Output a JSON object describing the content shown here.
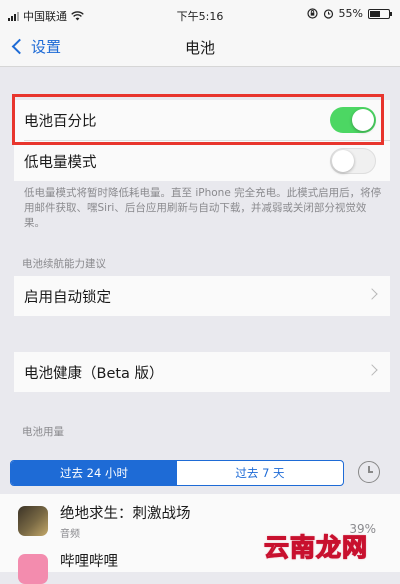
{
  "status_bar": {
    "carrier": "中国联通",
    "time": "下午5:16",
    "battery_percent": "55%",
    "battery_level": 0.55
  },
  "nav": {
    "back_label": "设置",
    "title": "电池"
  },
  "battery_percentage": {
    "label": "电池百分比",
    "enabled": true
  },
  "low_power_mode": {
    "label": "低电量模式",
    "enabled": false
  },
  "low_power_footnote": "低电量模式将暂时降低耗电量。直至 iPhone 完全充电。此模式启用后，将停用邮件获取、嘿Siri、后台应用刷新与自动下载，并减弱或关闭部分视觉效果。",
  "battery_life_suggestions": {
    "header": "电池续航能力建议",
    "auto_lock_label": "启用自动锁定"
  },
  "battery_health": {
    "label": "电池健康（Beta 版）"
  },
  "battery_usage": {
    "header": "电池用量",
    "segments": [
      "过去 24 小时",
      "过去 7 天"
    ],
    "selected_segment": 0
  },
  "apps": [
    {
      "name": "绝地求生：刺激战场",
      "subtitle": "音频",
      "percent": "39%"
    },
    {
      "name": "哔哩哔哩"
    }
  ],
  "watermark": "云南龙网",
  "colors": {
    "accent": "#1e6bd6",
    "toggle_on": "#4cd763",
    "highlight_border": "#e8352d"
  },
  "icons": [
    "wifi-icon",
    "alarm-icon",
    "lock-rotation-icon",
    "battery-icon",
    "chevron-left-icon",
    "chevron-right-icon",
    "clock-icon"
  ]
}
